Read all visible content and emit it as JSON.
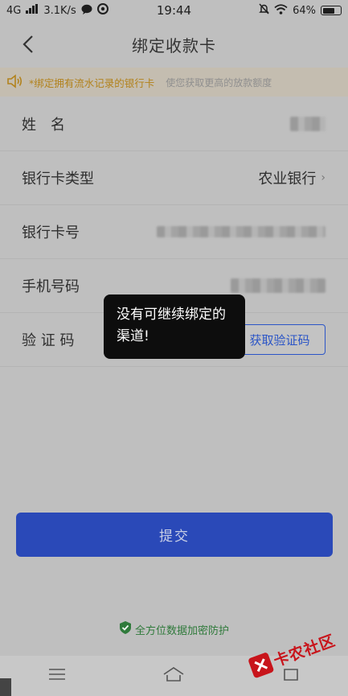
{
  "status_bar": {
    "network": "4G",
    "speed": "3.1K/s",
    "time": "19:44",
    "battery": "64%"
  },
  "nav": {
    "title": "绑定收款卡"
  },
  "notice": {
    "main": "*绑定拥有流水记录的银行卡",
    "sub": "使您获取更高的放款额度"
  },
  "form": {
    "name_label": "姓　名",
    "card_type_label": "银行卡类型",
    "card_type_value": "农业银行",
    "card_number_label": "银行卡号",
    "phone_label": "手机号码",
    "code_label": "验 证 码",
    "get_code_button": "获取验证码"
  },
  "toast": {
    "message": "没有可继续绑定的渠道!"
  },
  "submit": {
    "label": "提交"
  },
  "security": {
    "text": "全方位数据加密防护"
  },
  "watermark": {
    "text": "卡农社区"
  },
  "colors": {
    "primary": "#2a49b8",
    "notice": "#b2821c",
    "secure": "#2f7a3b",
    "watermark": "#c8141b"
  }
}
